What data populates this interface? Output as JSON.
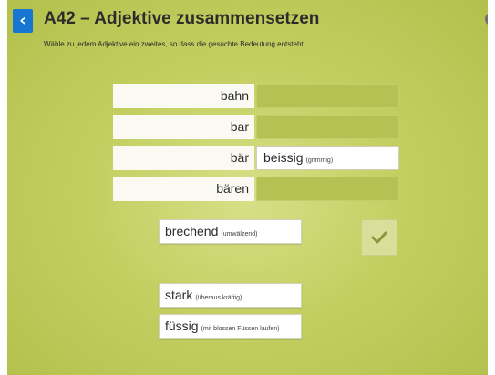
{
  "header": {
    "back_icon": "chevron-left-icon",
    "back_glyph": "‹",
    "title": "A42 – Adjektive zusammensetzen",
    "instruction": "Wähle zu jedem Adjektive ein zweites, so dass die gesuchte Bedeutung entsteht.",
    "help_icon": "question-icon",
    "help_glyph": "?"
  },
  "rows": [
    {
      "base": "bahn",
      "answer": "",
      "gloss": ""
    },
    {
      "base": "bar",
      "answer": "",
      "gloss": ""
    },
    {
      "base": "bär",
      "answer": "beissig",
      "gloss": "(grimmig)"
    },
    {
      "base": "bären",
      "answer": "",
      "gloss": ""
    }
  ],
  "cards": [
    {
      "word": "brechend",
      "gloss": "(umwälzend)"
    },
    {
      "word": "stark",
      "gloss": "(überaus kräftig)"
    },
    {
      "word": "füssig",
      "gloss": "(mit blossen Füssen laufen)"
    }
  ],
  "check_button": {
    "icon": "checkmark-icon"
  },
  "colors": {
    "accent": "#1676d2",
    "background": "#c4cf62",
    "empty_slot": "#b5c152",
    "check_mark": "#8f933c"
  }
}
